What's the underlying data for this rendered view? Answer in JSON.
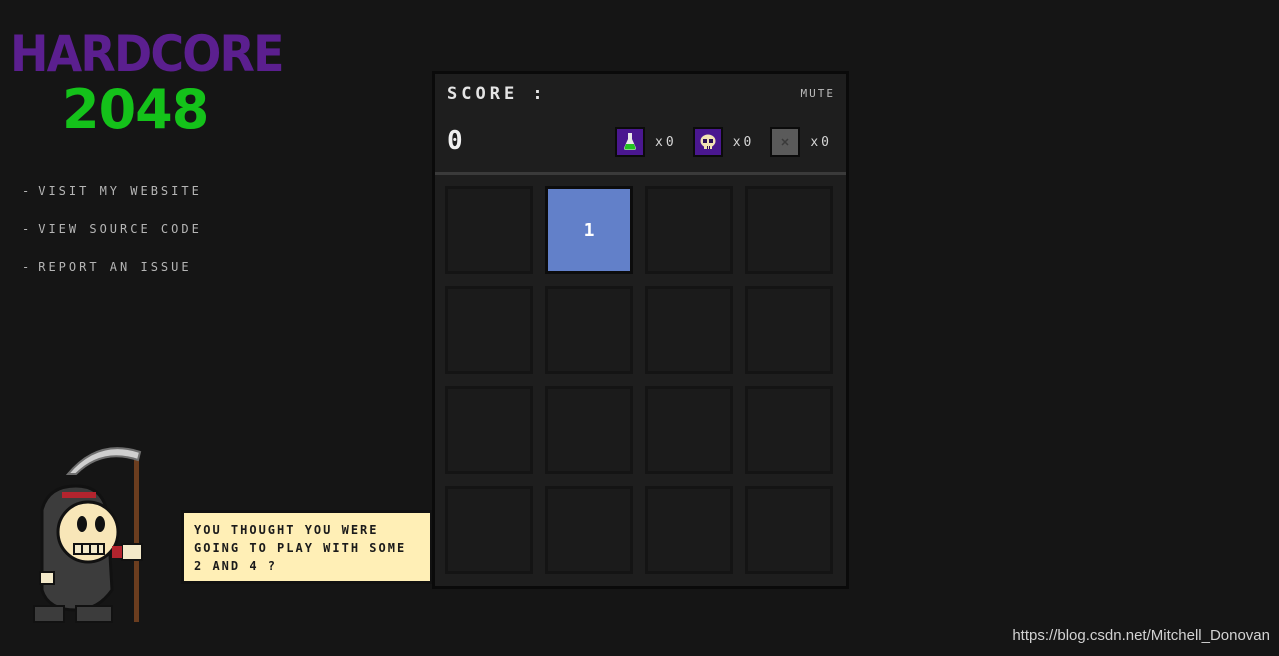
{
  "logo": {
    "line1": "HARDCORE",
    "line2": "2048"
  },
  "nav": [
    {
      "dash": "-",
      "label": "VISIT MY WEBSITE"
    },
    {
      "dash": "-",
      "label": "VIEW SOURCE CODE"
    },
    {
      "dash": "-",
      "label": "REPORT AN ISSUE"
    }
  ],
  "speech": {
    "text": "YOU THOUGHT YOU WERE\nGOING TO PLAY WITH SOME\n2 AND 4 ?"
  },
  "game": {
    "score_label": "SCORE :",
    "score_value": "0",
    "mute_label": "MUTE",
    "powerups": [
      {
        "icon": "potion-icon",
        "count": "x0"
      },
      {
        "icon": "skull-icon",
        "count": "x0"
      },
      {
        "icon": "stone-block-icon",
        "count": "x0"
      }
    ],
    "board": [
      [
        "",
        "1",
        "",
        ""
      ],
      [
        "",
        "",
        "",
        ""
      ],
      [
        "",
        "",
        "",
        ""
      ],
      [
        "",
        "",
        "",
        ""
      ]
    ],
    "tile_color": "#6280c9"
  },
  "watermark": "https://blog.csdn.net/Mitchell_Donovan",
  "colors": {
    "logo_purple": "#5b1f8f",
    "logo_green": "#14c21a",
    "bubble": "#ffefb6"
  }
}
